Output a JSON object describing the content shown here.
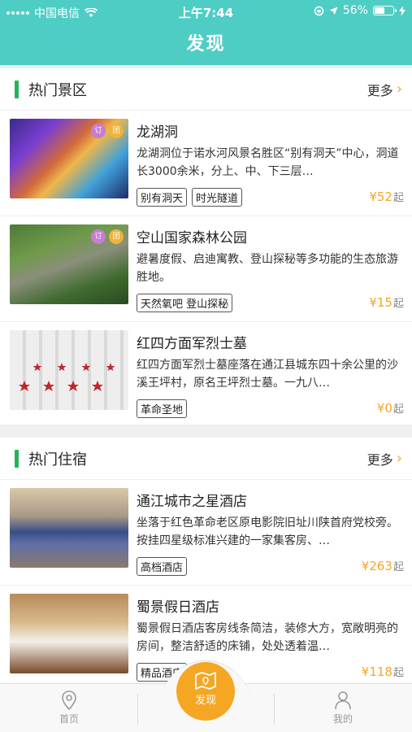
{
  "status": {
    "carrier": "中国电信",
    "time": "上午7:44",
    "battery": "56%",
    "battery_level": 0.56
  },
  "nav": {
    "title": "发现"
  },
  "sections": [
    {
      "title": "热门景区",
      "more": "更多",
      "items": [
        {
          "name": "龙湖洞",
          "desc": "龙湖洞位于诺水河风景名胜区“别有洞天”中心，洞道长3000余米，分上、中、下三层…",
          "tags": [
            "别有洞天",
            "时光隧道"
          ],
          "price": "¥52",
          "unit": "起",
          "badges": [
            "订",
            "团"
          ]
        },
        {
          "name": "空山国家森林公园",
          "desc": "避暑度假、启迪寓教、登山探秘等多功能的生态旅游胜地。",
          "tags": [
            "天然氧吧 登山探秘"
          ],
          "price": "¥15",
          "unit": "起",
          "badges": [
            "订",
            "团"
          ]
        },
        {
          "name": "红四方面军烈士墓",
          "desc": "红四方面军烈士墓座落在通江县城东四十余公里的沙溪王坪村，原名王坪烈士墓。一九八…",
          "tags": [
            "革命圣地"
          ],
          "price": "¥0",
          "unit": "起",
          "badges": []
        }
      ]
    },
    {
      "title": "热门住宿",
      "more": "更多",
      "items": [
        {
          "name": "通江城市之星酒店",
          "desc": "坐落于红色革命老区原电影院旧址川陕首府党校旁。按挂四星级标准兴建的一家集客房、…",
          "tags": [
            "高档酒店"
          ],
          "price": "¥263",
          "unit": "起",
          "badges": []
        },
        {
          "name": "蜀景假日酒店",
          "desc": "蜀景假日酒店客房线条简洁，装修大方，宽敞明亮的房间，整洁舒适的床铺，处处透着温…",
          "tags": [
            "精品酒店"
          ],
          "price": "¥118",
          "unit": "起",
          "badges": []
        }
      ]
    }
  ],
  "tabbar": {
    "home": "首页",
    "discover": "发现",
    "mine": "我的"
  },
  "colors": {
    "header": "#4ecdc4",
    "accent": "#f5a623",
    "section_bar": "#24b35e"
  }
}
